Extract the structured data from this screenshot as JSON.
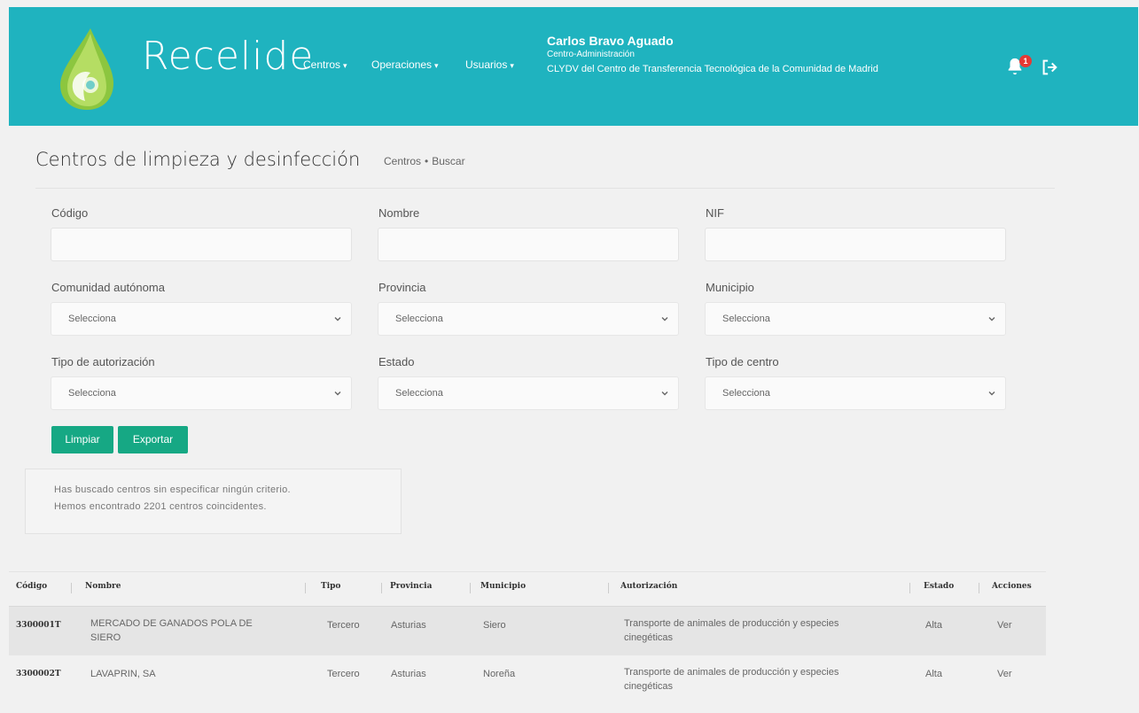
{
  "header": {
    "brand": "Recelide",
    "nav": [
      {
        "label": "Centros"
      },
      {
        "label": "Operaciones"
      },
      {
        "label": "Usuarios"
      }
    ],
    "user": {
      "name": "Carlos Bravo Aguado",
      "role": "Centro-Administración",
      "org": "CLYDV del Centro de Transferencia Tecnológica de la Comunidad de Madrid"
    },
    "notifications_count": "1",
    "icons": {
      "bell": "bell-icon",
      "logout": "logout-icon"
    },
    "colors": {
      "header_bg": "#1fb3bf",
      "button": "#16a884",
      "badge": "#e53935"
    }
  },
  "page": {
    "title": "Centros de limpieza y desinfección",
    "breadcrumb": [
      "Centros",
      "Buscar"
    ]
  },
  "form": {
    "codigo_label": "Código",
    "nombre_label": "Nombre",
    "nif_label": "NIF",
    "comunidad_label": "Comunidad autónoma",
    "provincia_label": "Provincia",
    "municipio_label": "Municipio",
    "tipo_aut_label": "Tipo de autorización",
    "estado_label": "Estado",
    "tipo_centro_label": "Tipo de centro",
    "select_placeholder": "Selecciona",
    "codigo_value": "",
    "nombre_value": "",
    "nif_value": ""
  },
  "buttons": {
    "limpiar": "Limpiar",
    "exportar": "Exportar"
  },
  "info": {
    "line1": "Has buscado centros sin especificar ningún criterio.",
    "line2": "Hemos encontrado 2201 centros coincidentes."
  },
  "table": {
    "headers": [
      "Código",
      "Nombre",
      "Tipo",
      "Provincia",
      "Municipio",
      "Autorización",
      "Estado",
      "Acciones"
    ],
    "rows": [
      {
        "codigo": "3300001T",
        "nombre_l1": "MERCADO DE GANADOS POLA DE",
        "nombre_l2": "SIERO",
        "tipo": "Tercero",
        "provincia": "Asturias",
        "municipio": "Siero",
        "aut_l1": "Transporte de animales de producción y especies",
        "aut_l2": "cinegéticas",
        "estado": "Alta",
        "accion": "Ver"
      },
      {
        "codigo": "3300002T",
        "nombre_l1": "LAVAPRIN, SA",
        "nombre_l2": "",
        "tipo": "Tercero",
        "provincia": "Asturias",
        "municipio": "Noreña",
        "aut_l1": "Transporte de animales de producción y especies",
        "aut_l2": "cinegéticas",
        "estado": "Alta",
        "accion": "Ver"
      }
    ]
  }
}
